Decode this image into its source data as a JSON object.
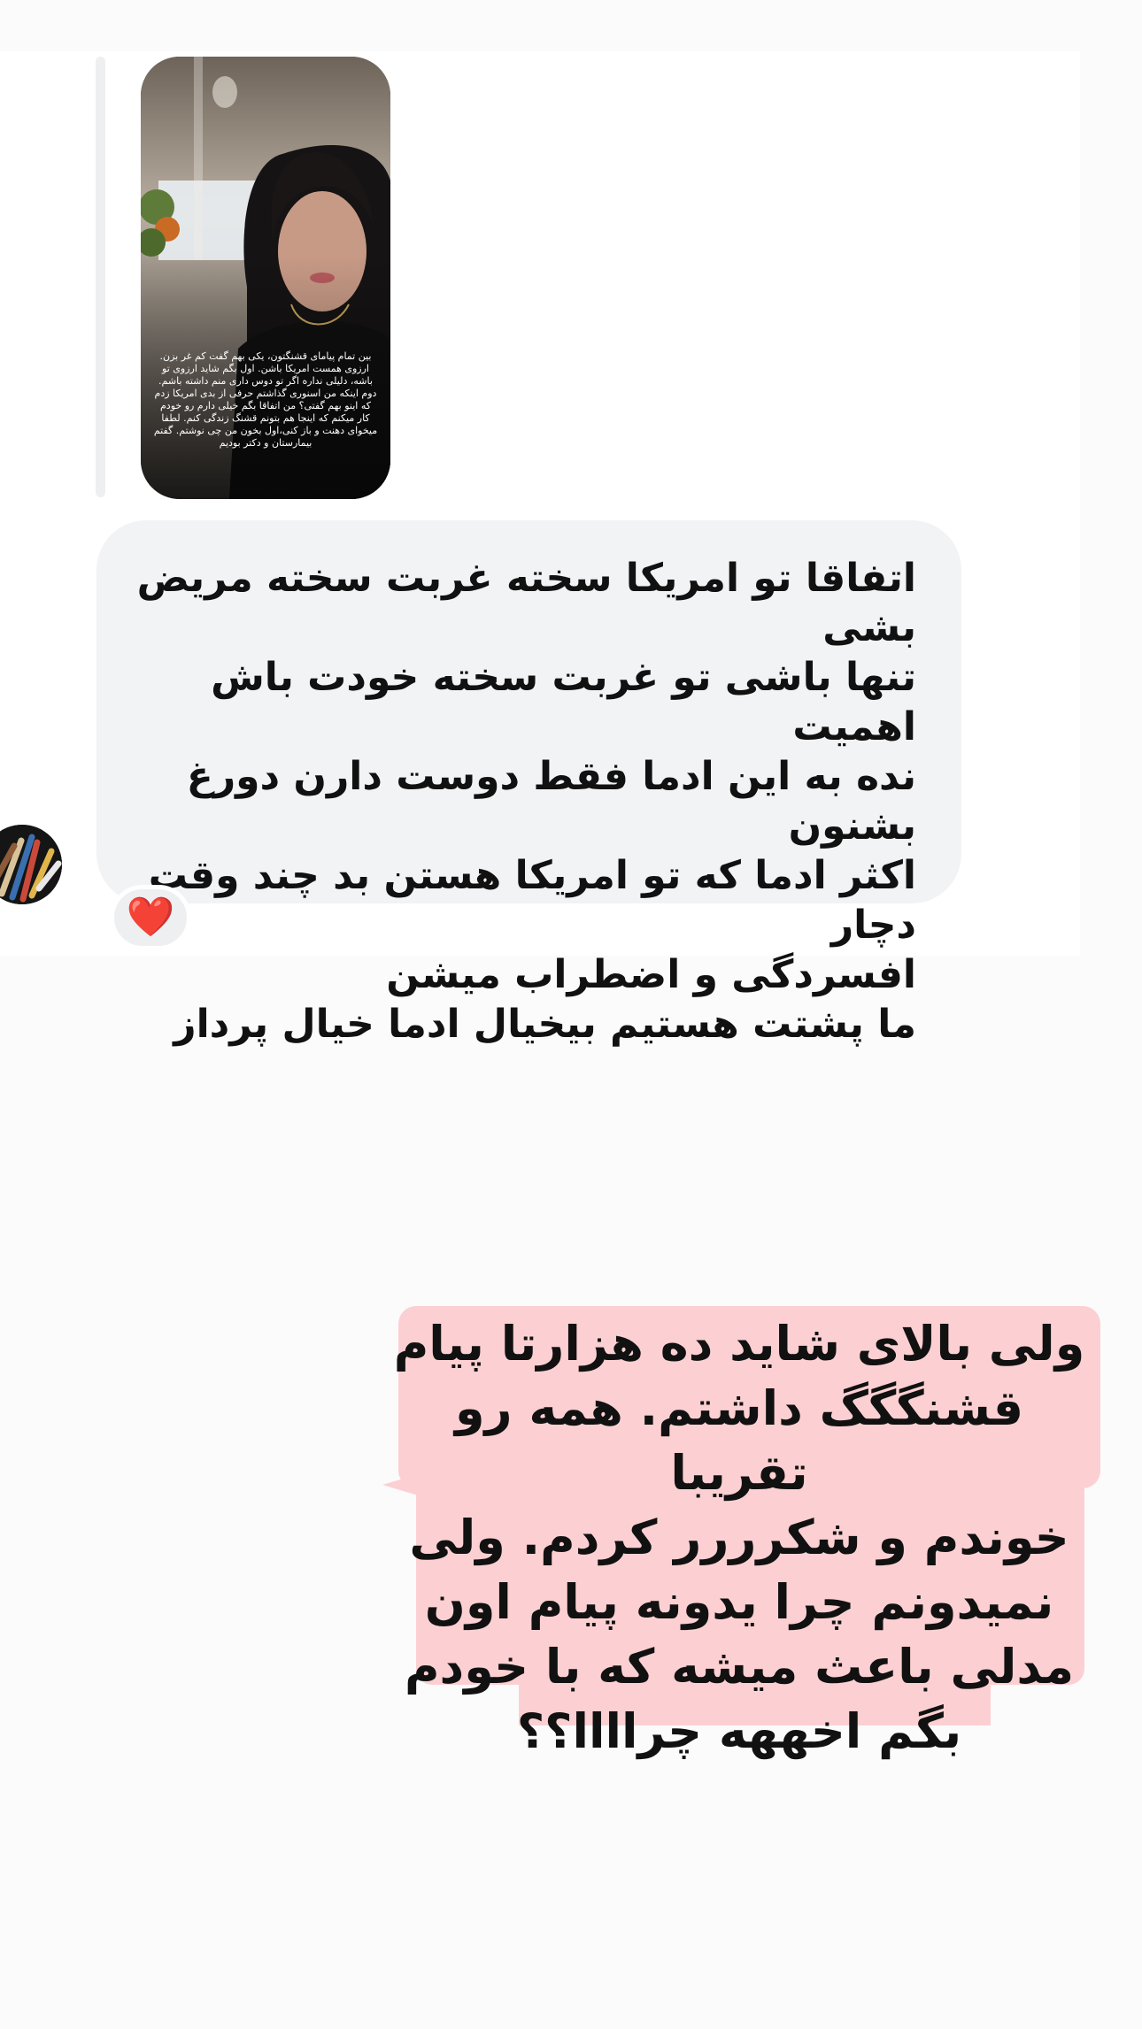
{
  "story_reply": {
    "thumbnail_caption": "بین تمام پیامای قشنگتون، یکی بهم گفت کم غر بزن. ارزوی همست امریکا باشن. اول بگم شاید ارزوی تو باشه، دلیلی نداره اگر تو دوس داری منم داشته باشم. دوم اینکه من اسنوری گذاشتم حرفی از بدی امریکا زدم که اینو بهم گفتی؟ من اتفاقا بگم خیلی دارم رو خودم کار میکنم که اینجا هم بتونم قشنگ زندگی کنم. لطفا میخوای دهنت و باز کنی،اول بخون من چی نوشتم. گفتم بیمارستان و دکتر بودیم"
  },
  "incoming_message": {
    "text": "اتفاقا تو امریکا سخته غربت سخته مریض بشی\nتنها باشی تو غربت سخته خودت باش  اهمیت\nنده به این ادما فقط دوست دارن دورغ بشنون\nاکثر ادما که تو امریکا هستن بد چند وقت دچار\nافسردگی و اضطراب میشن\nما پشتت هستیم بیخیال ادما خیال پرداز"
  },
  "reaction": {
    "emoji": "❤️"
  },
  "outgoing_message": {
    "text": "ولی بالای شاید ده هزارتا پیام\nقشنگگگ داشتم. همه رو تقریبا\nخوندم و شکرررر کردم. ولی\nنمیدونم چرا یدونه پیام اون\nمدلی باعث میشه که با خودم\nبگم اخههه چراااا؟؟"
  },
  "colors": {
    "background": "#fbfbfc",
    "incoming_bubble": "#f2f3f5",
    "outgoing_bubble": "#fcd0d2",
    "heart": "#e0203a"
  }
}
